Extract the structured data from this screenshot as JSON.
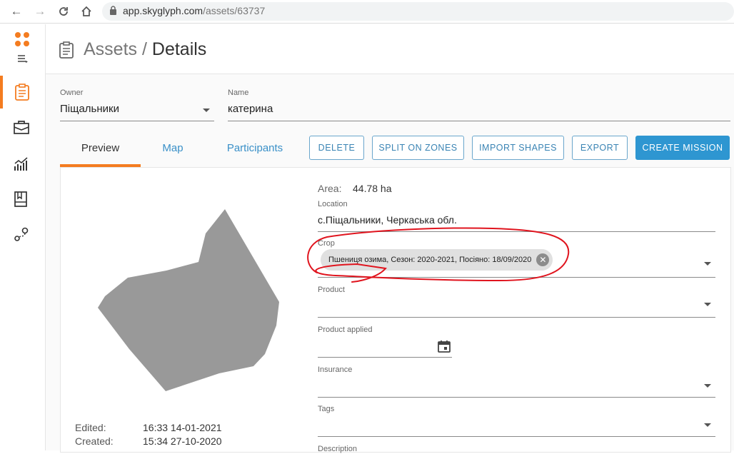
{
  "browser": {
    "url_host": "app.skyglyph.com",
    "url_path": "/assets/63737"
  },
  "header": {
    "breadcrumb_parent": "Assets",
    "breadcrumb_separator": "/",
    "breadcrumb_current": "Details"
  },
  "sidebar": {
    "items": [
      {
        "icon": "clipboard-icon",
        "active": true
      },
      {
        "icon": "briefcase-icon",
        "active": false
      },
      {
        "icon": "analytics-icon",
        "active": false
      },
      {
        "icon": "notebook-icon",
        "active": false
      },
      {
        "icon": "route-icon",
        "active": false
      }
    ]
  },
  "form": {
    "owner_label": "Owner",
    "owner_value": "Піщальники",
    "name_label": "Name",
    "name_value": "катерина"
  },
  "tabs": [
    {
      "label": "Preview",
      "active": true
    },
    {
      "label": "Map",
      "active": false
    },
    {
      "label": "Participants",
      "active": false
    }
  ],
  "actions": {
    "delete": "DELETE",
    "split": "SPLIT ON ZONES",
    "import": "IMPORT SHAPES",
    "export": "EXPORT",
    "create": "CREATE MISSION"
  },
  "details": {
    "area_label": "Area:",
    "area_value": "44.78 ha",
    "location_label": "Location",
    "location_value": "с.Піщальники, Черкаська обл.",
    "crop_label": "Crop",
    "crop_chip": "Пшениця озима, Сезон: 2020-2021, Посіяно: 18/09/2020",
    "product_label": "Product",
    "product_applied_label": "Product applied",
    "insurance_label": "Insurance",
    "tags_label": "Tags",
    "description_label": "Description"
  },
  "meta": {
    "edited_label": "Edited:",
    "edited_value": "16:33 14-01-2021",
    "created_label": "Created:",
    "created_value": "15:34 27-10-2020"
  },
  "colors": {
    "accent_orange": "#f47c20",
    "primary_blue": "#2e96d1",
    "annotation_red": "#e0141e",
    "field_shape": "#999999"
  }
}
